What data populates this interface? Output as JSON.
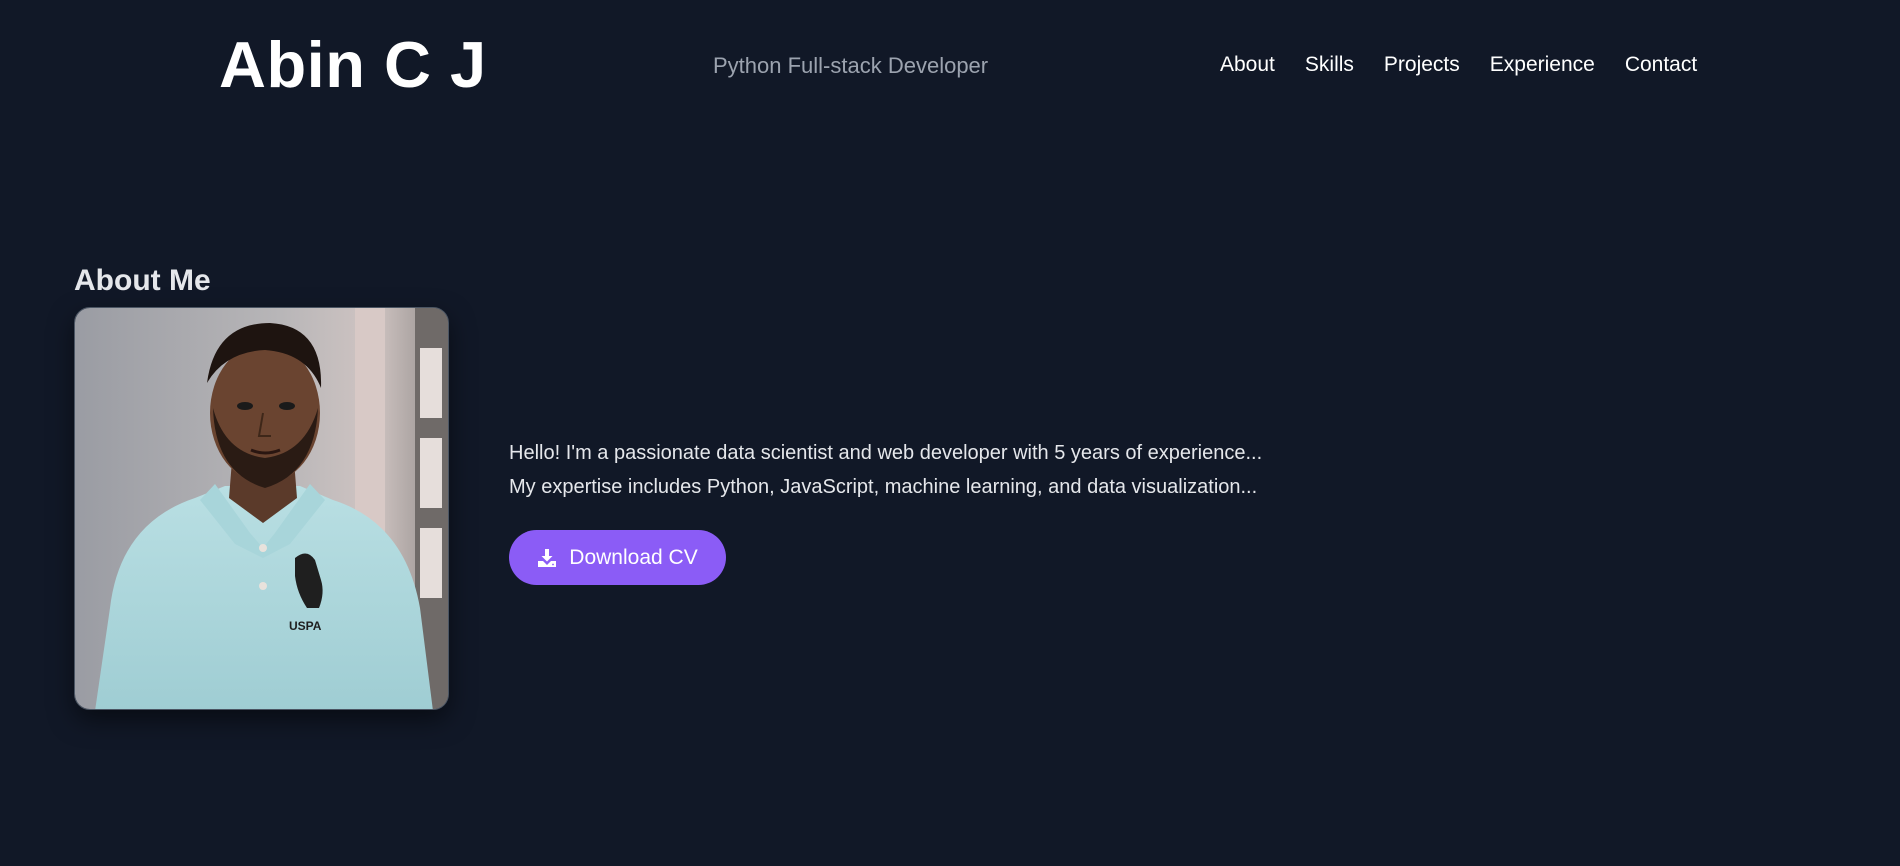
{
  "header": {
    "site_name": "Abin C J",
    "tagline": "Python Full-stack Developer",
    "nav": [
      "About",
      "Skills",
      "Projects",
      "Experience",
      "Contact"
    ]
  },
  "about": {
    "heading": "About Me",
    "paragraphs": [
      "Hello! I'm a passionate data scientist and web developer with 5 years of experience...",
      "My expertise includes Python, JavaScript, machine learning, and data visualization..."
    ],
    "download_button": "Download CV",
    "download_icon": "download-icon"
  },
  "colors": {
    "background": "#111827",
    "accent": "#8b5cf6",
    "text": "#ffffff",
    "muted": "#9ca3af"
  }
}
